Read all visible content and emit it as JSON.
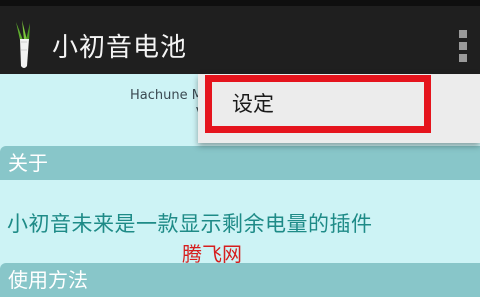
{
  "action_bar": {
    "title": "小初音电池",
    "app_icon": "leek-icon",
    "overflow_icon": "overflow-menu-icon"
  },
  "header": {
    "subtitle_visible": "Hachune M",
    "subtitle_2_visible": "V"
  },
  "sections": {
    "about_label": "关于",
    "about_text": "小初音未来是一款显示剩余电量的插件",
    "usage_label": "使用方法"
  },
  "popup_menu": {
    "items": [
      {
        "label": "设定"
      }
    ]
  },
  "watermark": "腾飞网",
  "colors": {
    "action_bar_bg": "#1f1f1f",
    "content_bg": "#cdf3f5",
    "section_header_bg": "#88c6c9",
    "about_text": "#1e8b87",
    "highlight_border": "#e5141d",
    "menu_bg": "#ececec",
    "watermark": "#d61e1e"
  }
}
